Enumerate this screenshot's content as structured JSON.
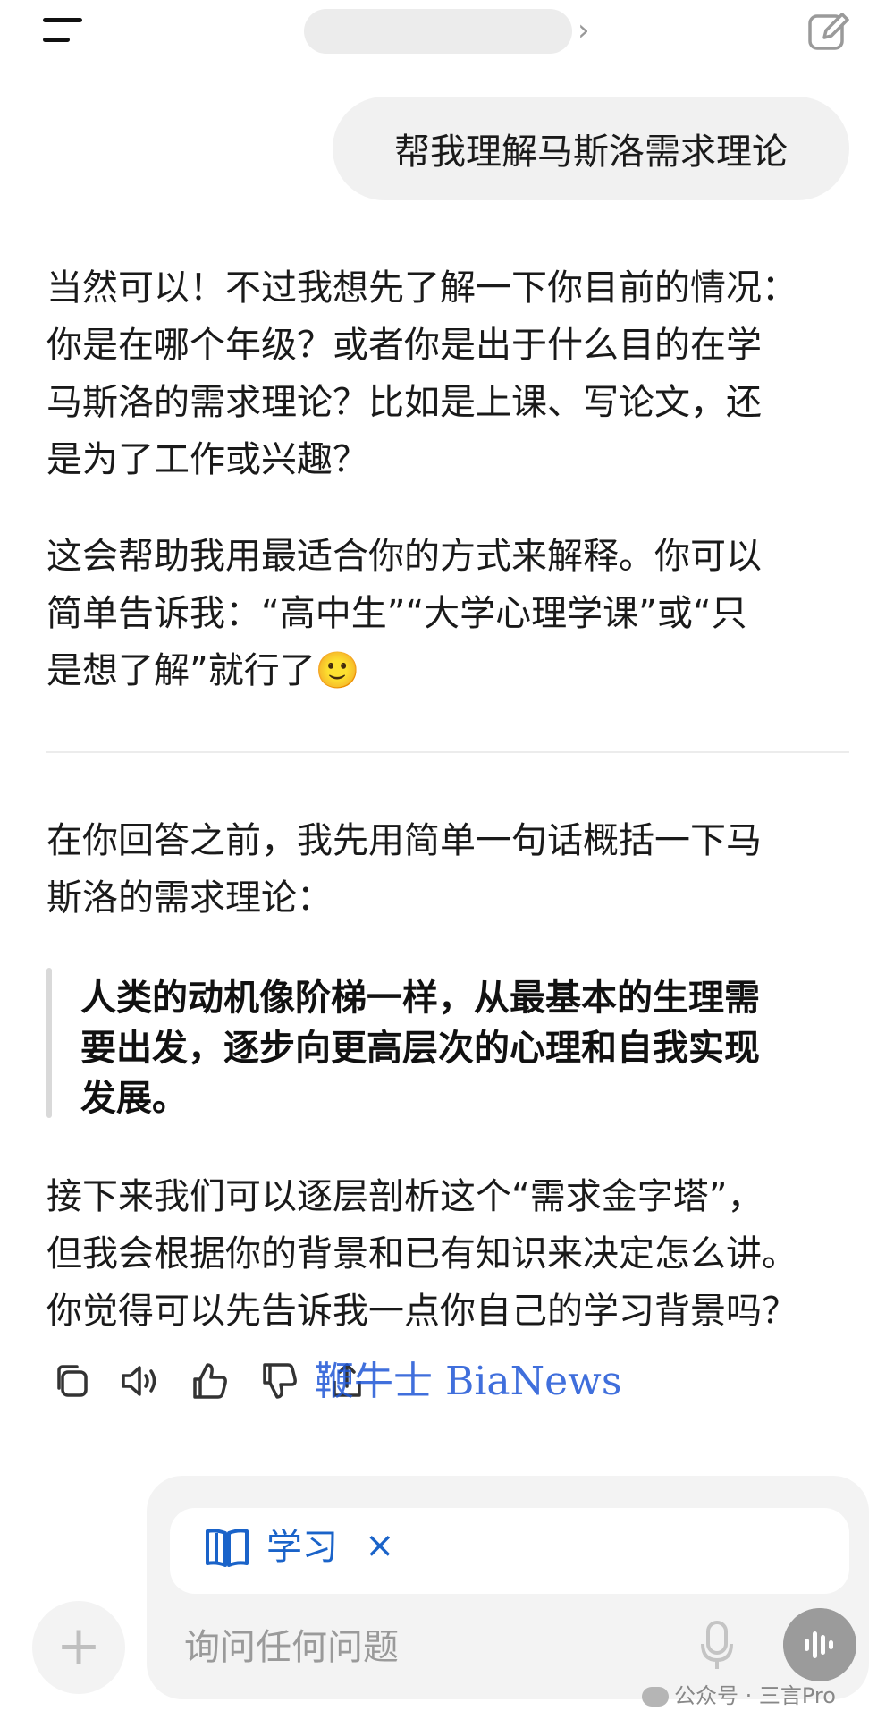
{
  "header": {
    "title": "",
    "chevron": "›",
    "menu_icon": "menu-icon",
    "edit_icon": "edit-icon"
  },
  "user_message": "帮我理解马斯洛需求理论",
  "assistant": {
    "paragraphs": [
      [
        "当然可以！不过我想先了解一下你目前的情况：",
        "你是在哪个年级？或者你是出于什么目的在学",
        "马斯洛的需求理论？比如是上课、写论文，还",
        "是为了工作或兴趣？"
      ],
      [
        "这会帮助我用最适合你的方式来解释。你可以",
        "简单告诉我：“高中生”“大学心理学课”或“只",
        "是想了解”就行了🙂"
      ],
      [
        "在你回答之前，我先用简单一句话概括一下马",
        "斯洛的需求理论："
      ],
      [
        "接下来我们可以逐层剖析这个“需求金字塔”，",
        "但我会根据你的背景和已有知识来决定怎么讲。",
        "你觉得可以先告诉我一点你自己的学习背景吗？"
      ]
    ],
    "quote": [
      "人类的动机像阶梯一样，从最基本的生理需",
      "要出发，逐步向更高层次的心理和自我实现",
      "发展。"
    ]
  },
  "actions": [
    "copy-icon",
    "speaker-icon",
    "thumbs-up-icon",
    "thumbs-down-icon",
    "share-icon"
  ],
  "watermark": "鞭牛士 BiaNews",
  "composer": {
    "study_label": "学习",
    "study_close": "×",
    "placeholder": "询问任何问题",
    "plus": "+"
  },
  "footer_watermark": "公众号 · 三言Pro",
  "colors": {
    "accent": "#1a63c9",
    "watermark": "#1f57d6"
  }
}
